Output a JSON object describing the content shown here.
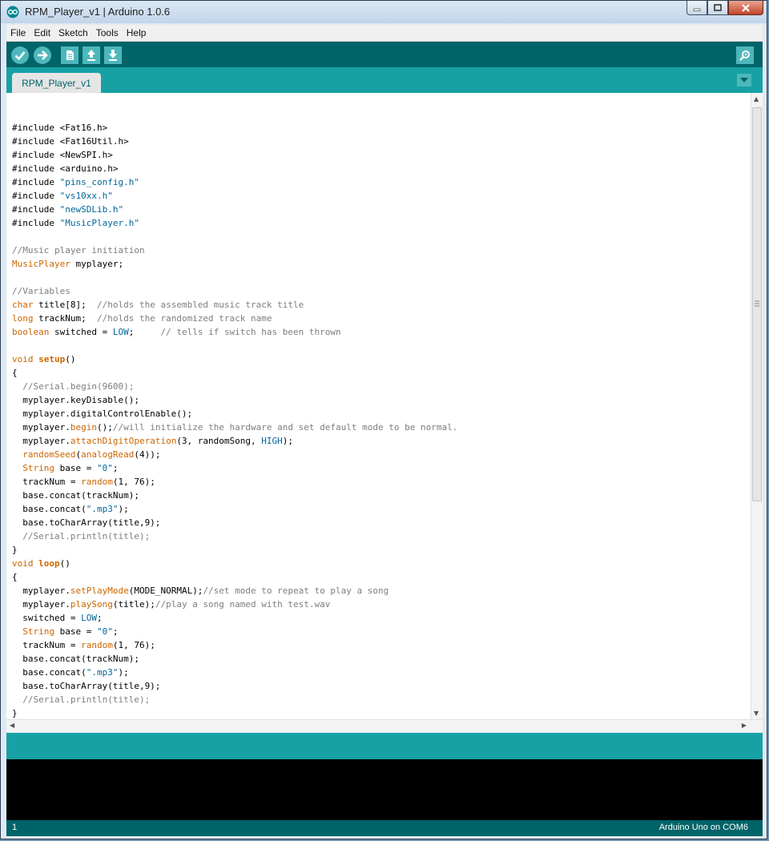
{
  "window": {
    "title": "RPM_Player_v1 | Arduino 1.0.6"
  },
  "menu": [
    "File",
    "Edit",
    "Sketch",
    "Tools",
    "Help"
  ],
  "toolbar": {
    "buttons": [
      "check-icon",
      "arrow-right-icon",
      "new-file-icon",
      "upload-arrow-icon",
      "download-arrow-icon"
    ],
    "serial_monitor": "magnifier-icon"
  },
  "tabs": [
    {
      "label": "RPM_Player_v1",
      "active": true
    }
  ],
  "code_lines": [
    "",
    "#include <Fat16.h>",
    "#include <Fat16Util.h>",
    "#include <NewSPI.h>",
    "#include <arduino.h>",
    "#include \"pins_config.h\"",
    "#include \"vs10xx.h\"",
    "#include \"newSDLib.h\"",
    "#include \"MusicPlayer.h\"",
    "",
    "//Music player initiation",
    "MusicPlayer myplayer;",
    "",
    "//Variables",
    "char title[8];  //holds the assembled music track title",
    "long trackNum;  //holds the randomized track name",
    "boolean switched = LOW;     // tells if switch has been thrown",
    "",
    "void setup()",
    "{",
    "  //Serial.begin(9600);",
    "  myplayer.keyDisable();",
    "  myplayer.digitalControlEnable();",
    "  myplayer.begin();//will initialize the hardware and set default mode to be normal.",
    "  myplayer.attachDigitOperation(3, randomSong, HIGH);",
    "  randomSeed(analogRead(4));",
    "  String base = \"0\";",
    "  trackNum = random(1, 76);",
    "  base.concat(trackNum);",
    "  base.concat(\".mp3\");",
    "  base.toCharArray(title,9);",
    "  //Serial.println(title);",
    "}",
    "void loop()",
    "{",
    "  myplayer.setPlayMode(MODE_NORMAL);//set mode to repeat to play a song",
    "  myplayer.playSong(title);//play a song named with test.wav",
    "  switched = LOW;",
    "  String base = \"0\";",
    "  trackNum = random(1, 76);",
    "  base.concat(trackNum);",
    "  base.concat(\".mp3\");",
    "  base.toCharArray(title,9);",
    "  //Serial.println(title);",
    "}"
  ],
  "status": {
    "line_number": "1",
    "board": "Arduino Uno on COM6"
  },
  "colors": {
    "toolbar": "#006468",
    "tabbar": "#17a1a5",
    "keyword": "#cc6600",
    "string": "#006699",
    "comment": "#7e7e7e"
  }
}
